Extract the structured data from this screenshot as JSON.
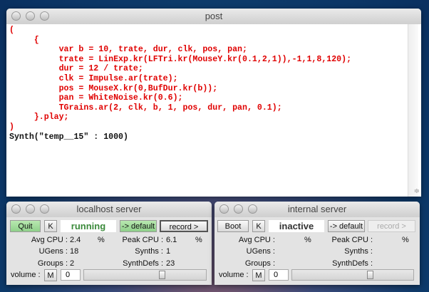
{
  "post": {
    "title": "post",
    "code_lines": [
      "(",
      "\t{",
      "\t\tvar b = 10, trate, dur, clk, pos, pan;",
      "\t\ttrate = LinExp.kr(LFTri.kr(MouseY.kr(0.1,2,1)),-1,1,8,120);",
      "\t\tdur = 12 / trate;",
      "\t\tclk = Impulse.ar(trate);",
      "\t\tpos = MouseX.kr(0,BufDur.kr(b));",
      "\t\tpan = WhiteNoise.kr(0.6);",
      "\t\tTGrains.ar(2, clk, b, 1, pos, dur, pan, 0.1);",
      "\t}.play;",
      ")"
    ],
    "output": "Synth(\"temp__15\" : 1000)"
  },
  "localhost": {
    "title": "localhost server",
    "boot_label": "Quit",
    "kill_label": "K",
    "status": "running",
    "default_label": "-> default",
    "record_label": "record >",
    "avg_cpu_label": "Avg CPU :",
    "avg_cpu": "2.4",
    "pct": "%",
    "peak_cpu_label": "Peak CPU :",
    "peak_cpu": "6.1",
    "ugens_label": "UGens :",
    "ugens": "18",
    "synths_label": "Synths :",
    "synths": "1",
    "groups_label": "Groups :",
    "groups": "2",
    "synthdefs_label": "SynthDefs :",
    "synthdefs": "23",
    "volume_label": "volume :",
    "mute_label": "M",
    "volume": "0",
    "volume_slider": 0.65
  },
  "internal": {
    "title": "internal server",
    "boot_label": "Boot",
    "kill_label": "K",
    "status": "inactive",
    "default_label": "-> default",
    "record_label": "record >",
    "avg_cpu_label": "Avg CPU :",
    "pct": "%",
    "peak_cpu_label": "Peak CPU :",
    "ugens_label": "UGens :",
    "synths_label": "Synths :",
    "groups_label": "Groups :",
    "synthdefs_label": "SynthDefs :",
    "volume_label": "volume :",
    "mute_label": "M",
    "volume": "0",
    "volume_slider": 0.65
  },
  "colors": {
    "running": "#3a8a3a",
    "inactive": "#333333",
    "code": "#e00000"
  }
}
